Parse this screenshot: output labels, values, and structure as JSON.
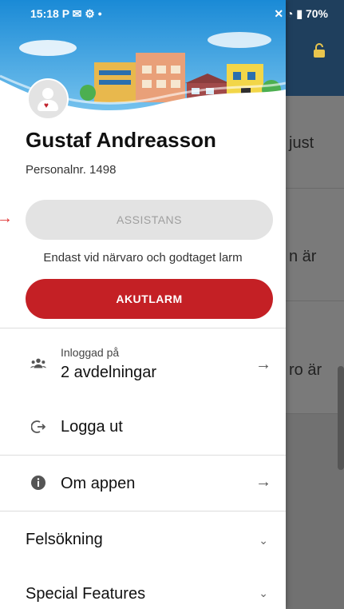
{
  "status": {
    "time": "15:18",
    "left_icons": "P ✉ ⚙ •",
    "battery": "70%"
  },
  "background": {
    "row_texts": [
      "just",
      "n är",
      "ro är"
    ]
  },
  "drawer": {
    "user_name": "Gustaf Andreasson",
    "personal_nr": "Personalnr. 1498",
    "assist_label": "ASSISTANS",
    "assist_note": "Endast vid närvaro och godtaget larm",
    "akut_label": "AKUTLARM",
    "logged_in_label": "Inloggad på",
    "departments": "2 avdelningar",
    "logout_label": "Logga ut",
    "about_label": "Om appen",
    "troubleshoot_label": "Felsökning",
    "special_label": "Special Features"
  },
  "colors": {
    "akut": "#c42025",
    "header_blue": "#1f3f5d"
  }
}
